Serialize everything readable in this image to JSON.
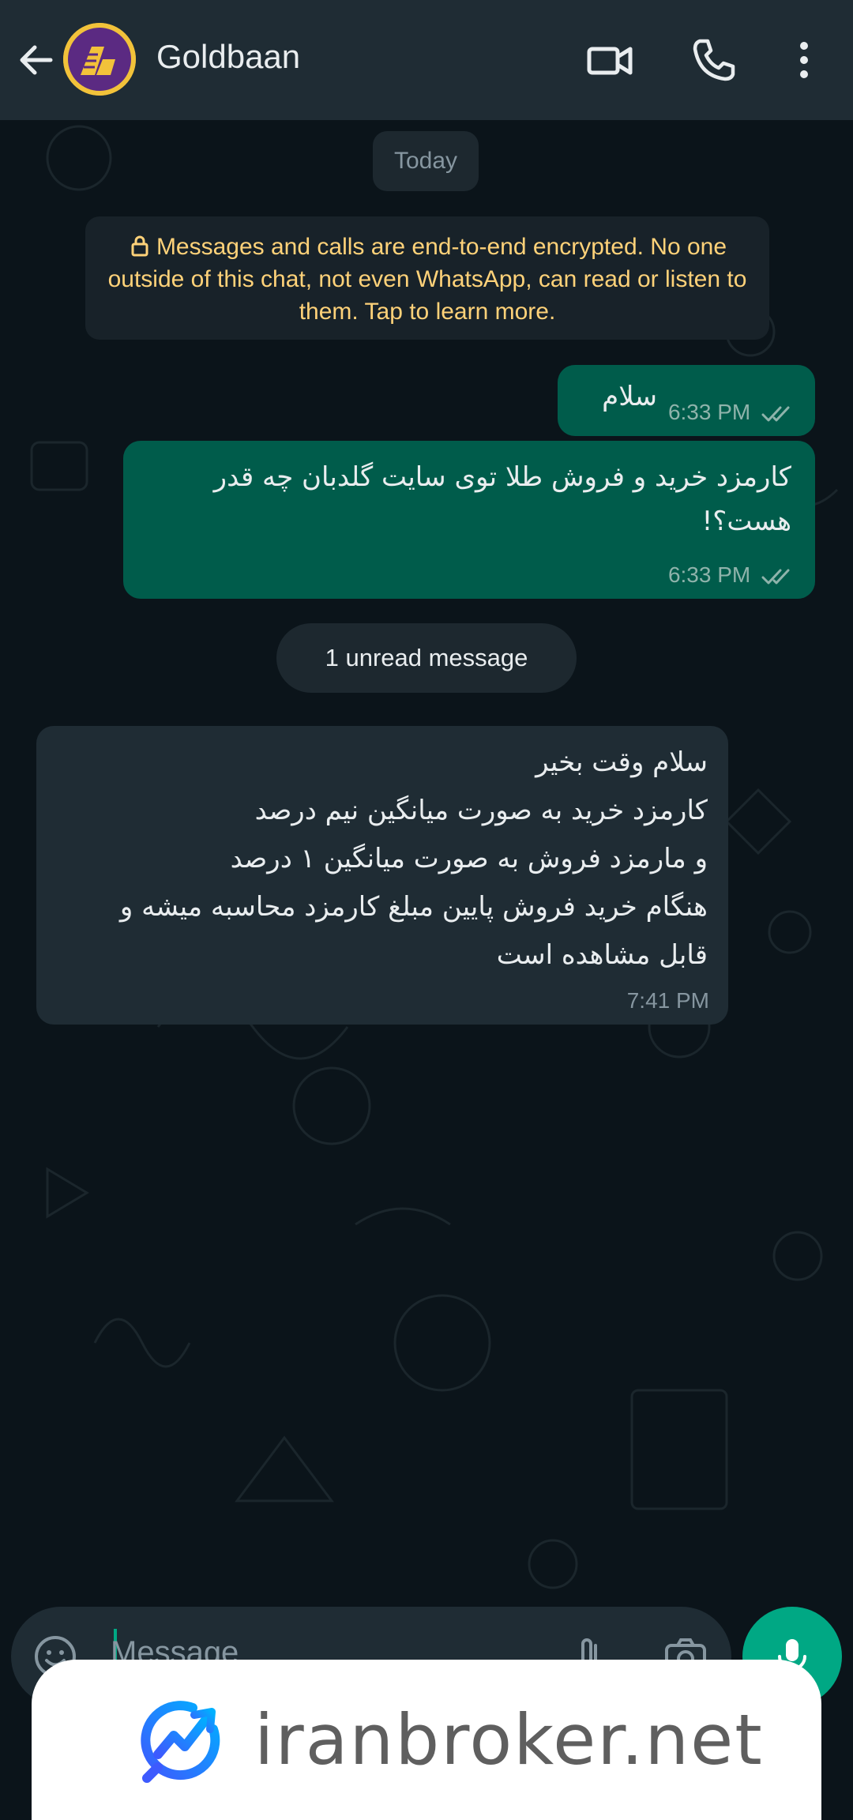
{
  "header": {
    "contact_name": "Goldbaan",
    "icons": [
      "back-arrow-icon",
      "video-call-icon",
      "voice-call-icon",
      "more-options-icon"
    ]
  },
  "chat": {
    "date_chip": "Today",
    "encryption_notice": "Messages and calls are end-to-end encrypted. No one outside of this chat, not even WhatsApp, can read or listen to them. Tap to learn more.",
    "messages": [
      {
        "direction": "outgoing",
        "lines": [
          "سلام"
        ],
        "time": "6:33 PM",
        "status": "read"
      },
      {
        "direction": "outgoing",
        "lines": [
          "کارمزد خرید و فروش طلا توی سایت گلدبان چه قدر",
          "هست؟!"
        ],
        "time": "6:33 PM",
        "status": "read"
      },
      {
        "direction": "incoming",
        "lines": [
          "سلام وقت بخیر",
          "کارمزد خرید به صورت میانگین نیم درصد",
          "و مارمزد فروش به صورت میانگین ۱ درصد",
          "هنگام خرید فروش پایین مبلغ کارمزد محاسبه میشه و",
          "قابل مشاهده است"
        ],
        "time": "7:41 PM"
      }
    ],
    "unread_label": "1 unread message"
  },
  "composer": {
    "placeholder": "Message"
  },
  "watermark": {
    "text": "iranbroker.net"
  },
  "colors": {
    "header_bg": "#1f2c34",
    "chat_bg": "#0b141a",
    "outgoing_bubble": "#005c4b",
    "incoming_bubble": "#1f2c34",
    "accent": "#00a884",
    "notice_text": "#ffd279"
  }
}
